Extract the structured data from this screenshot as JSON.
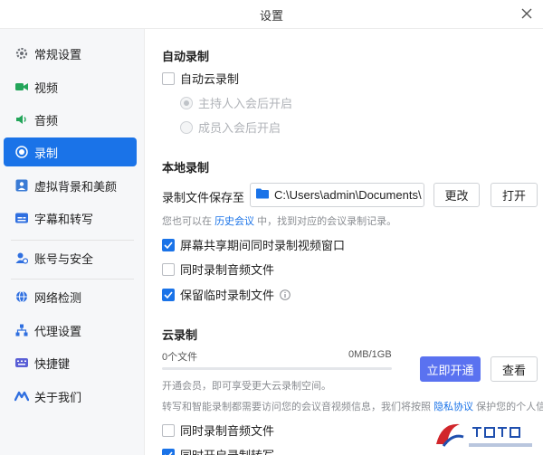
{
  "window": {
    "title": "设置"
  },
  "sidebar": {
    "items": [
      {
        "label": "常规设置",
        "icon": "gear-icon"
      },
      {
        "label": "视频",
        "icon": "video-icon"
      },
      {
        "label": "音频",
        "icon": "speaker-icon"
      },
      {
        "label": "录制",
        "icon": "record-icon",
        "active": true
      },
      {
        "label": "虚拟背景和美颜",
        "icon": "portrait-icon"
      },
      {
        "label": "字幕和转写",
        "icon": "subtitle-icon"
      },
      {
        "label": "账号与安全",
        "icon": "account-security-icon"
      },
      {
        "label": "网络检测",
        "icon": "globe-icon"
      },
      {
        "label": "代理设置",
        "icon": "network-tree-icon"
      },
      {
        "label": "快捷键",
        "icon": "keyboard-icon"
      },
      {
        "label": "关于我们",
        "icon": "tencent-meeting-logo-icon"
      }
    ]
  },
  "auto_record": {
    "title": "自动录制",
    "cloud_label": "自动云录制",
    "cloud_checked": false,
    "options": [
      "主持人入会后开启",
      "成员入会后开启"
    ]
  },
  "local_record": {
    "title": "本地录制",
    "save_label": "录制文件保存至",
    "path": "C:\\Users\\admin\\Documents\\",
    "change_button": "更改",
    "open_button": "打开",
    "hint_prefix": "您也可以在 ",
    "hint_link": "历史会议",
    "hint_suffix": " 中，找到对应的会议录制记录。",
    "options": [
      {
        "label": "屏幕共享期间同时录制视频窗口",
        "checked": true
      },
      {
        "label": "同时录制音频文件",
        "checked": false
      },
      {
        "label": "保留临时录制文件",
        "checked": true,
        "info_icon": "info-icon"
      }
    ]
  },
  "cloud_record": {
    "title": "云录制",
    "files_label": "0个文件",
    "usage_label": "0MB/1GB",
    "usage_fraction": 0,
    "open_button": "立即开通",
    "view_button": "查看",
    "member_hint": "开通会员，即可享受更大云录制空间。",
    "privacy_prefix": "转写和智能录制都需要访问您的会议音视频信息，我们将按照 ",
    "privacy_link": "隐私协议",
    "privacy_suffix": " 保护您的个人信息。",
    "options": [
      {
        "label": "同时录制音频文件",
        "checked": false
      },
      {
        "label": "同时开启录制转写",
        "checked": true
      }
    ]
  },
  "colors": {
    "accent": "#1a73e8",
    "primary_button": "#5a72f0"
  }
}
